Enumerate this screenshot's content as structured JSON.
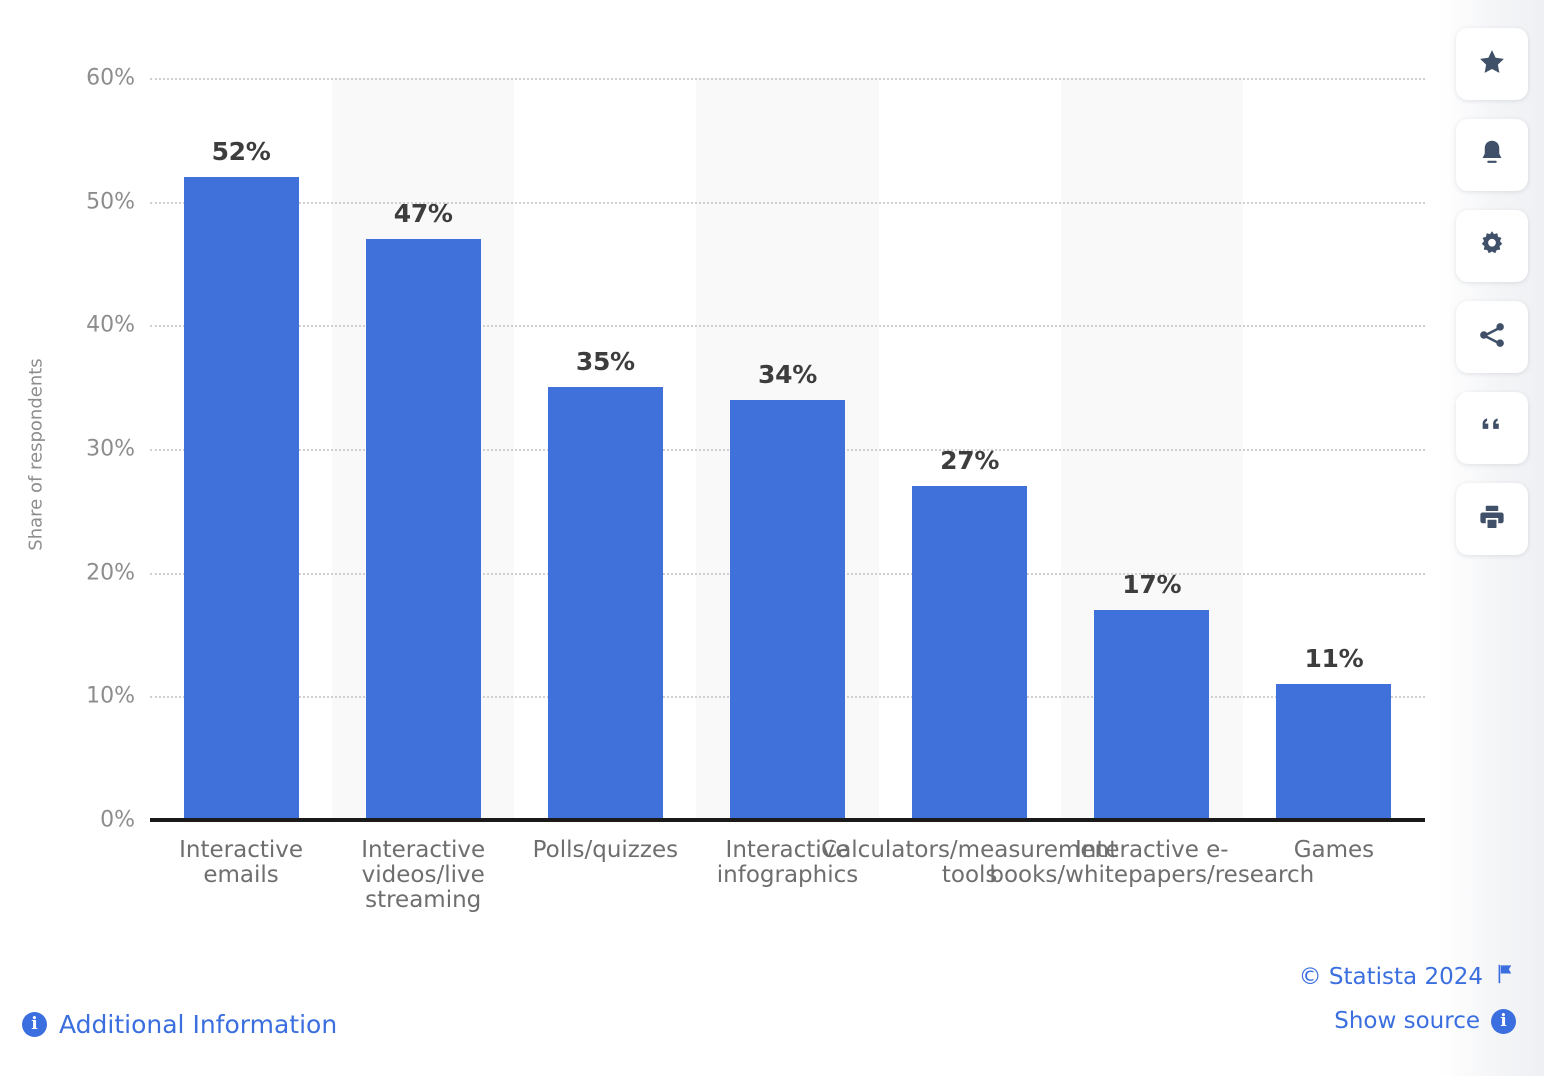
{
  "chart_data": {
    "type": "bar",
    "title": "",
    "xlabel": "",
    "ylabel": "Share of respondents",
    "ylim": [
      0,
      60
    ],
    "ytick_labels": [
      "60%",
      "50%",
      "40%",
      "30%",
      "20%",
      "10%",
      "0%"
    ],
    "ytick_values": [
      60,
      50,
      40,
      30,
      20,
      10,
      0
    ],
    "grid": true,
    "legend": "none",
    "bar_color": "#4070da",
    "categories": [
      "Interactive emails",
      "Interactive videos/live streaming",
      "Polls/quizzes",
      "Interactive infographics",
      "Calculators/measurement tools",
      "Interactive e-books/whitepapers/research",
      "Games"
    ],
    "category_lines": [
      "Interactive\nemails",
      "Interactive\nvideos/live\nstreaming",
      "Polls/quizzes",
      "Interactive\ninfographics",
      "Calculators/measurement\ntools",
      "Interactive e-\nbooks/whitepapers/research",
      "Games"
    ],
    "values": [
      52,
      47,
      35,
      34,
      27,
      17,
      11
    ],
    "value_labels": [
      "52%",
      "47%",
      "35%",
      "34%",
      "27%",
      "17%",
      "11%"
    ]
  },
  "toolbar": {
    "items": [
      {
        "icon": "star-icon",
        "label": "Favorite"
      },
      {
        "icon": "bell-icon",
        "label": "Notifications"
      },
      {
        "icon": "gear-icon",
        "label": "Settings"
      },
      {
        "icon": "share-icon",
        "label": "Share"
      },
      {
        "icon": "quote-icon",
        "label": "Cite"
      },
      {
        "icon": "print-icon",
        "label": "Print"
      }
    ]
  },
  "footer": {
    "additional_information": "Additional Information",
    "copyright": "© Statista 2024",
    "show_source": "Show source",
    "info_glyph": "i"
  },
  "colors": {
    "bar": "#4070da",
    "link": "#3b6fdf",
    "axis_text": "#8d8d8d",
    "label_text": "#6e6e6e",
    "value_text": "#3d3d3d",
    "band": "#f9f9fa"
  }
}
